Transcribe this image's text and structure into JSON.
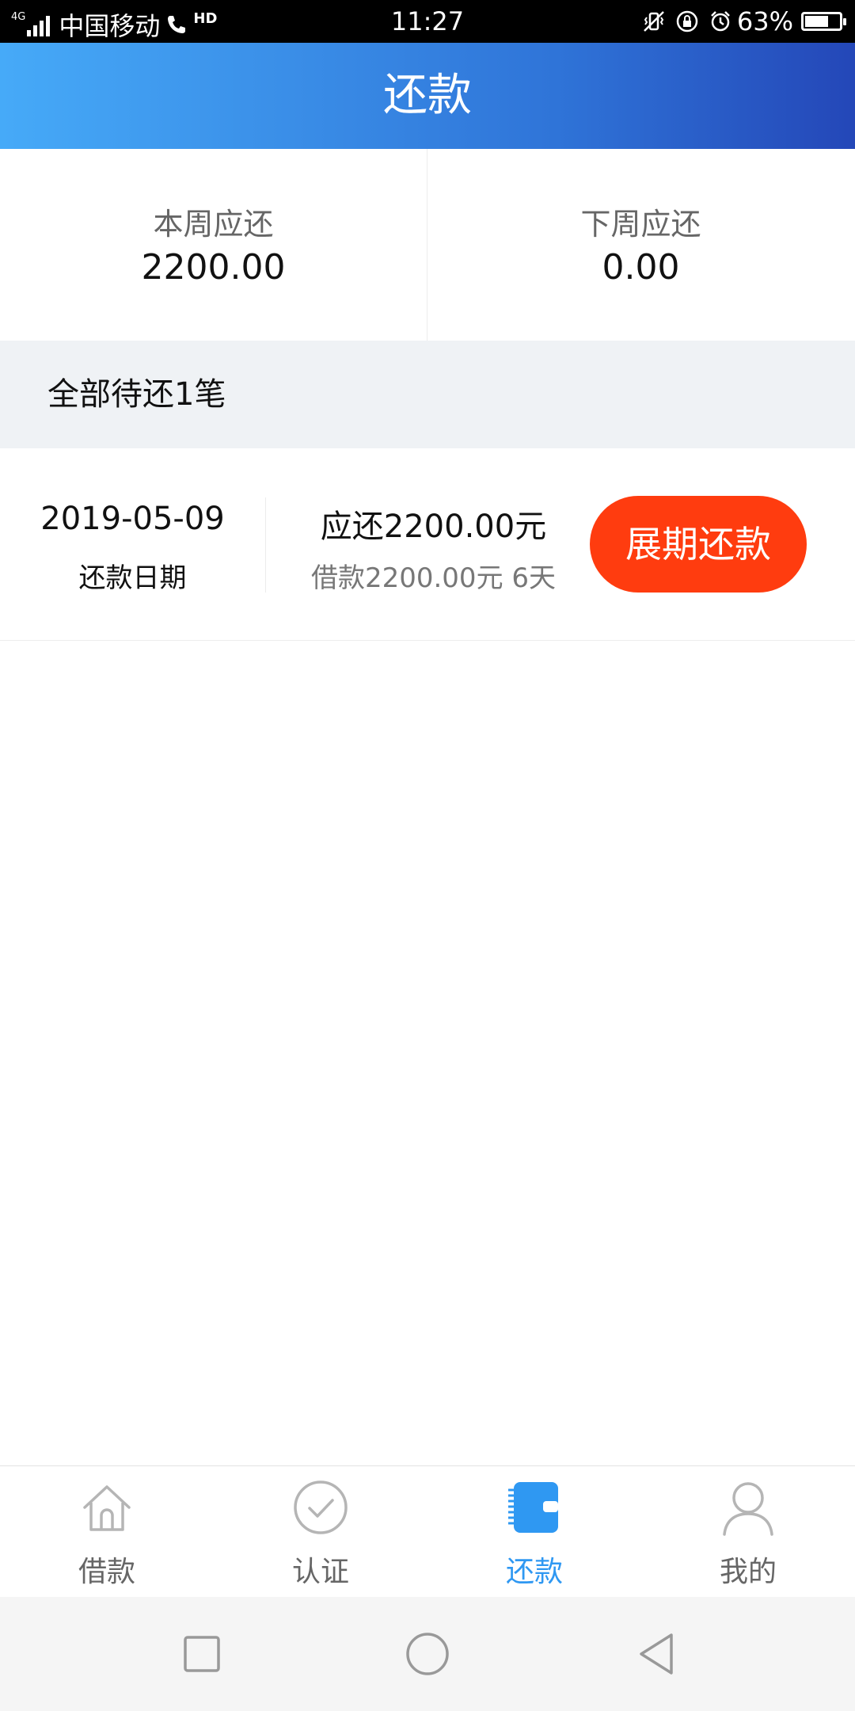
{
  "status_bar": {
    "network_type": "4G",
    "carrier": "中国移动",
    "hd_label": "HD",
    "time": "11:27",
    "battery_percent": "63%",
    "battery_level": 0.63
  },
  "header": {
    "title": "还款"
  },
  "summary": {
    "this_week_label": "本周应还",
    "this_week_value": "2200.00",
    "next_week_label": "下周应还",
    "next_week_value": "0.00"
  },
  "pending": {
    "title": "全部待还1笔"
  },
  "records": [
    {
      "date": "2019-05-09",
      "date_label": "还款日期",
      "due": "应还2200.00元",
      "detail": "借款2200.00元 6天",
      "button": "展期还款"
    }
  ],
  "nav": {
    "items": [
      {
        "label": "借款",
        "icon": "home-icon",
        "active": false
      },
      {
        "label": "认证",
        "icon": "check-circle-icon",
        "active": false
      },
      {
        "label": "还款",
        "icon": "wallet-icon",
        "active": true
      },
      {
        "label": "我的",
        "icon": "user-icon",
        "active": false
      }
    ]
  },
  "colors": {
    "accent_blue": "#2f98f2",
    "header_gradient_start": "#46aaf8",
    "header_gradient_end": "#2447b8",
    "button_red": "#ff3c0f"
  }
}
